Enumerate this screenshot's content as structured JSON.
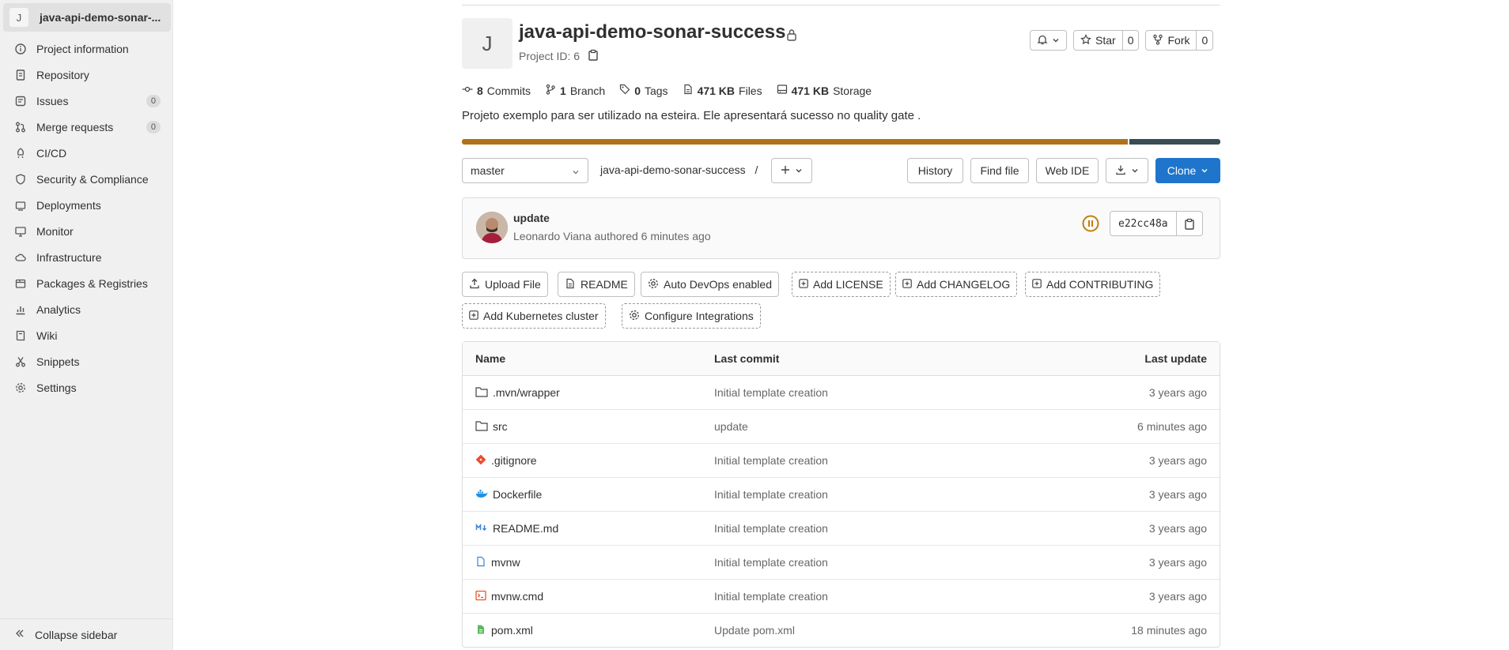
{
  "sidebar": {
    "project_initial": "J",
    "project_name": "java-api-demo-sonar-...",
    "items": [
      {
        "label": "Project information",
        "icon": "info-icon"
      },
      {
        "label": "Repository",
        "icon": "doc-icon"
      },
      {
        "label": "Issues",
        "icon": "issues-icon",
        "count": "0"
      },
      {
        "label": "Merge requests",
        "icon": "merge-icon",
        "count": "0"
      },
      {
        "label": "CI/CD",
        "icon": "rocket-icon"
      },
      {
        "label": "Security & Compliance",
        "icon": "shield-icon"
      },
      {
        "label": "Deployments",
        "icon": "deploy-icon"
      },
      {
        "label": "Monitor",
        "icon": "monitor-icon"
      },
      {
        "label": "Infrastructure",
        "icon": "cloud-icon"
      },
      {
        "label": "Packages & Registries",
        "icon": "package-icon"
      },
      {
        "label": "Analytics",
        "icon": "chart-icon"
      },
      {
        "label": "Wiki",
        "icon": "book-icon"
      },
      {
        "label": "Snippets",
        "icon": "scissors-icon"
      },
      {
        "label": "Settings",
        "icon": "gear-icon"
      }
    ],
    "collapse_label": "Collapse sidebar"
  },
  "project": {
    "initial": "J",
    "title": "java-api-demo-sonar-success",
    "id_label": "Project ID: 6",
    "star_label": "Star",
    "star_count": "0",
    "fork_label": "Fork",
    "fork_count": "0",
    "stats": {
      "commits_num": "8",
      "commits_label": "Commits",
      "branch_num": "1",
      "branch_label": "Branch",
      "tags_num": "0",
      "tags_label": "Tags",
      "files_num": "471 KB",
      "files_label": "Files",
      "storage_num": "471 KB",
      "storage_label": "Storage"
    },
    "description": "Projeto exemplo para ser utilizado na esteira. Ele apresentará sucesso no quality gate .",
    "language_bar": [
      {
        "percent": 88,
        "color": "#b07219"
      },
      {
        "percent": 12,
        "color": "#384d54"
      }
    ]
  },
  "toolbar": {
    "branch": "master",
    "breadcrumb": "java-api-demo-sonar-success",
    "breadcrumb_sep": "/",
    "history": "History",
    "find_file": "Find file",
    "web_ide": "Web IDE",
    "clone": "Clone"
  },
  "commit": {
    "title": "update",
    "author": "Leonardo Viana",
    "meta_rest": "authored 6 minutes ago",
    "sha": "e22cc48a"
  },
  "actions": {
    "upload": "Upload File",
    "readme": "README",
    "autodevops": "Auto DevOps enabled",
    "license": "Add LICENSE",
    "changelog": "Add CHANGELOG",
    "contributing": "Add CONTRIBUTING",
    "kubernetes": "Add Kubernetes cluster",
    "integrations": "Configure Integrations"
  },
  "table": {
    "headers": {
      "name": "Name",
      "commit": "Last commit",
      "update": "Last update"
    },
    "rows": [
      {
        "name": ".mvn/wrapper",
        "icon": "folder-icon",
        "commit": "Initial template creation",
        "update": "3 years ago"
      },
      {
        "name": "src",
        "icon": "folder-icon",
        "commit": "update",
        "update": "6 minutes ago"
      },
      {
        "name": ".gitignore",
        "icon": "git-icon",
        "commit": "Initial template creation",
        "update": "3 years ago"
      },
      {
        "name": "Dockerfile",
        "icon": "docker-icon",
        "commit": "Initial template creation",
        "update": "3 years ago"
      },
      {
        "name": "README.md",
        "icon": "markdown-icon",
        "commit": "Initial template creation",
        "update": "3 years ago"
      },
      {
        "name": "mvnw",
        "icon": "file-icon",
        "commit": "Initial template creation",
        "update": "3 years ago"
      },
      {
        "name": "mvnw.cmd",
        "icon": "terminal-icon",
        "commit": "Initial template creation",
        "update": "3 years ago"
      },
      {
        "name": "pom.xml",
        "icon": "xml-icon",
        "commit": "Update pom.xml",
        "update": "18 minutes ago"
      }
    ]
  }
}
